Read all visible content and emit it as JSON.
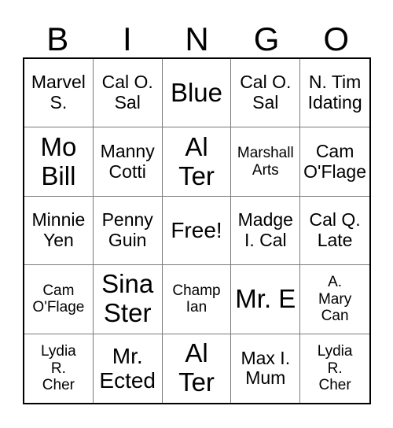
{
  "card": {
    "headers": [
      "B",
      "I",
      "N",
      "G",
      "O"
    ],
    "rows": [
      [
        {
          "text": "Marvel\nS.",
          "size": "fs-md"
        },
        {
          "text": "Cal O.\nSal",
          "size": "fs-md"
        },
        {
          "text": "Blue",
          "size": "fs-xl"
        },
        {
          "text": "Cal O.\nSal",
          "size": "fs-md"
        },
        {
          "text": "N. Tim\nIdating",
          "size": "fs-md"
        }
      ],
      [
        {
          "text": "Mo\nBill",
          "size": "fs-xl"
        },
        {
          "text": "Manny\nCotti",
          "size": "fs-md"
        },
        {
          "text": "Al\nTer",
          "size": "fs-xl"
        },
        {
          "text": "Marshall\nArts",
          "size": "fs-sm"
        },
        {
          "text": "Cam\nO'Flage",
          "size": "fs-md"
        }
      ],
      [
        {
          "text": "Minnie\nYen",
          "size": "fs-md"
        },
        {
          "text": "Penny\nGuin",
          "size": "fs-md"
        },
        {
          "text": "Free!",
          "size": "fs-lg"
        },
        {
          "text": "Madge\nI. Cal",
          "size": "fs-md"
        },
        {
          "text": "Cal Q.\nLate",
          "size": "fs-md"
        }
      ],
      [
        {
          "text": "Cam\nO'Flage",
          "size": "fs-sm"
        },
        {
          "text": "Sina\nSter",
          "size": "fs-xl"
        },
        {
          "text": "Champ\nIan",
          "size": "fs-sm"
        },
        {
          "text": "Mr. E",
          "size": "fs-xl"
        },
        {
          "text": "A.\nMary\nCan",
          "size": "fs-sm"
        }
      ],
      [
        {
          "text": "Lydia\nR.\nCher",
          "size": "fs-sm"
        },
        {
          "text": "Mr.\nEcted",
          "size": "fs-lg"
        },
        {
          "text": "Al\nTer",
          "size": "fs-xl"
        },
        {
          "text": "Max I.\nMum",
          "size": "fs-md"
        },
        {
          "text": "Lydia\nR.\nCher",
          "size": "fs-sm"
        }
      ]
    ],
    "free_space": {
      "row": 2,
      "col": 2,
      "label": "Free!"
    },
    "colors": {
      "background": "#ffffff",
      "text": "#000000",
      "outer_border": "#000000",
      "inner_border": "#7a7a7a"
    }
  }
}
